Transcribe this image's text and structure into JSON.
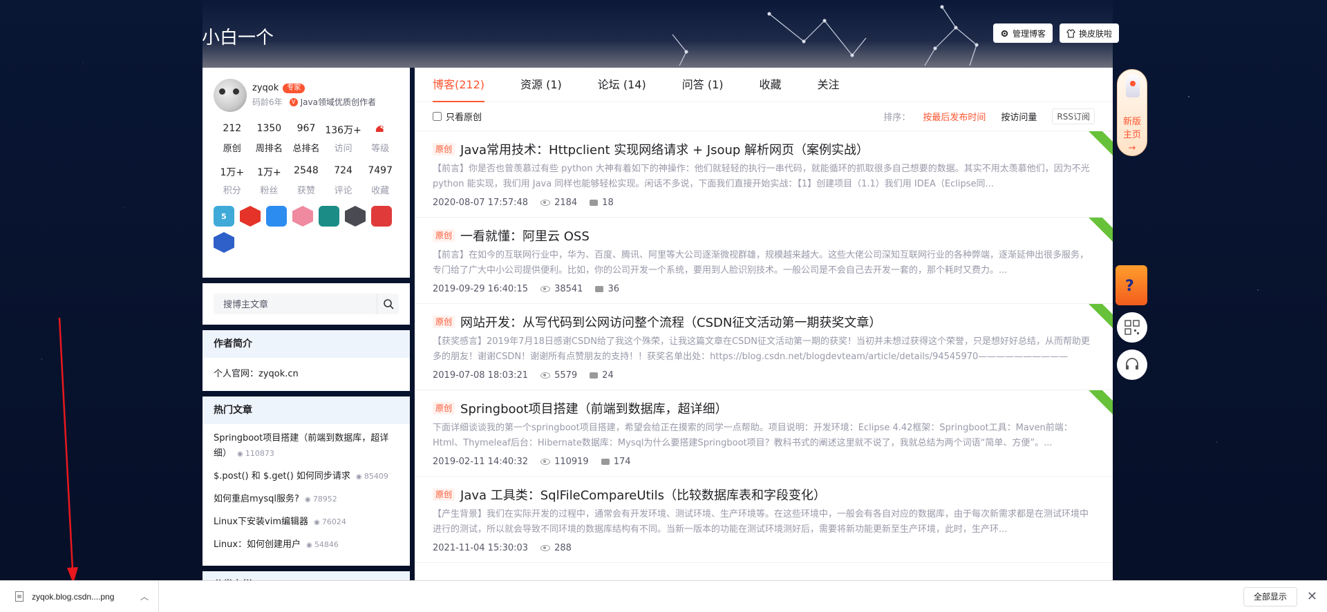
{
  "blog": {
    "title": "小白一个"
  },
  "top_buttons": {
    "manage": "管理博客",
    "skin": "换皮肤啦"
  },
  "profile": {
    "name": "zyqok",
    "expert_badge": "专家",
    "code_age": "码龄6年",
    "creator_title": "Java领域优质创作者",
    "stats_row1": [
      {
        "num": "212",
        "label": "原创"
      },
      {
        "num": "1350",
        "label": "周排名"
      },
      {
        "num": "967",
        "label": "总排名"
      },
      {
        "num": "136万+",
        "label": "访问"
      },
      {
        "num": "",
        "label": "等级"
      }
    ],
    "stats_row2": [
      {
        "num": "1万+",
        "label": "积分"
      },
      {
        "num": "1万+",
        "label": "粉丝"
      },
      {
        "num": "2548",
        "label": "获赞"
      },
      {
        "num": "724",
        "label": "评论"
      },
      {
        "num": "7497",
        "label": "收藏"
      }
    ],
    "medals": [
      {
        "icon": "medal-5-years-icon",
        "color": "#3fa9d8",
        "text": "5"
      },
      {
        "icon": "medal-red-hex-icon",
        "color": "#e5332a",
        "text": ""
      },
      {
        "icon": "medal-blue-mask-icon",
        "color": "#2d8cf0",
        "text": ""
      },
      {
        "icon": "medal-pink-avatar-icon",
        "color": "#f08aa0",
        "text": ""
      },
      {
        "icon": "medal-teal-list-icon",
        "color": "#1b8c86",
        "text": ""
      },
      {
        "icon": "medal-dark-card-icon",
        "color": "#4a4a52",
        "text": ""
      },
      {
        "icon": "medal-red-pen-icon",
        "color": "#e03a3a",
        "text": ""
      },
      {
        "icon": "medal-blue-rocket-icon",
        "color": "#2f5fc8",
        "text": ""
      }
    ]
  },
  "search": {
    "placeholder": "搜博主文章"
  },
  "intro": {
    "heading": "作者简介",
    "text": "个人官网：zyqok.cn"
  },
  "hot": {
    "heading": "热门文章",
    "items": [
      {
        "title": "Springboot项目搭建（前端到数据库，超详细）",
        "views": "110873"
      },
      {
        "title": "$.post() 和 $.get() 如何同步请求",
        "views": "85409"
      },
      {
        "title": "如何重启mysql服务?",
        "views": "78952"
      },
      {
        "title": "Linux下安装vim编辑器",
        "views": "76024"
      },
      {
        "title": "Linux：如何创建用户",
        "views": "54846"
      }
    ]
  },
  "category": {
    "heading": "分类专栏"
  },
  "tabs": [
    {
      "label": "博客(212)",
      "active": true
    },
    {
      "label": "资源 (1)",
      "active": false
    },
    {
      "label": "论坛 (14)",
      "active": false
    },
    {
      "label": "问答 (1)",
      "active": false
    },
    {
      "label": "收藏",
      "active": false
    },
    {
      "label": "关注",
      "active": false
    }
  ],
  "filter": {
    "only_original": "只看原创",
    "sort_label": "排序：",
    "sort_latest": "按最后发布时间",
    "sort_views": "按访问量",
    "rss": "RSS订阅"
  },
  "articles": [
    {
      "tag": "原创",
      "title": "Java常用技术：Httpclient 实现网络请求 + Jsoup 解析网页（案例实战）",
      "desc": "【前言】你是否也曾羡慕过有些 python 大神有着如下的神操作：他们就轻轻的执行一串代码，就能循环的抓取很多自己想要的数据。其实不用太羡慕他们，因为不光 python 能实现，我们用 Java 同样也能够轻松实现。闲话不多说，下面我们直接开始实战：【1】创建项目（1.1）我们用 IDEA（Eclipse同...",
      "date": "2020-08-07 17:57:48",
      "views": "2184",
      "comments": "18"
    },
    {
      "tag": "原创",
      "title": "一看就懂：阿里云 OSS",
      "desc": "【前言】在如今的互联网行业中，华为、百度、腾讯、阿里等大公司逐渐微视群雄，规模越来越大。这些大佬公司深知互联网行业的各种弊端，逐渐延伸出很多服务，专门给了广大中小公司提供便利。比如，你的公司开发一个系统，要用到人脸识别技术。一般公司是不会自己去开发一套的，那个耗时又费力。...",
      "date": "2019-09-29 16:40:15",
      "views": "38541",
      "comments": "36"
    },
    {
      "tag": "原创",
      "title": "网站开发：从写代码到公网访问整个流程（CSDN征文活动第一期获奖文章）",
      "desc": "【获奖感言】2019年7月18日感谢CSDN给了我这个殊荣，让我这篇文章在CSDN征文活动第一期的获奖！当初并未想过获得这个荣誉，只是想好好总结，从而帮助更多的朋友！谢谢CSDN！谢谢所有点赞朋友的支持！！获奖名单出处：https://blog.csdn.net/blogdevteam/article/details/94545970——————————",
      "date": "2019-07-08 18:03:21",
      "views": "5579",
      "comments": "24"
    },
    {
      "tag": "原创",
      "title": "Springboot项目搭建（前端到数据库，超详细）",
      "desc": "下面详细谈谈我的第一个springboot项目搭建，希望会给正在摸索的同学一点帮助。项目说明：开发环境：Eclipse 4.42框架：Springboot工具：Maven前端：Html、Thymeleaf后台：Hibernate数据库：Mysql为什么要搭建Springboot项目？教科书式的阐述这里就不说了，我就总结为两个词语“简单、方便”。...",
      "date": "2019-02-11 14:40:32",
      "views": "110919",
      "comments": "174"
    },
    {
      "tag": "原创",
      "title": "Java 工具类：SqlFileCompareUtils（比较数据库表和字段变化）",
      "desc": "【产生背景】我们在实际开发的过程中，通常会有开发环境、测试环境、生产环境等。在这些环境中，一般会有各自对应的数据库，由于每次新需求都是在测试环境中进行的测试，所以就会导致不同环境的数据库结构有不同。当新一版本的功能在测试环境测好后，需要将新功能更新至生产环境，此时，生产环...",
      "date": "2021-11-04 15:30:03",
      "views": "288",
      "comments": ""
    }
  ],
  "side_tools": {
    "new_home": "新版\n主页"
  },
  "download_bar": {
    "file": "zyqok.blog.csdn....png",
    "show_all": "全部显示"
  },
  "colors": {
    "accent": "#fc5531",
    "page_bg": "#07122e"
  }
}
